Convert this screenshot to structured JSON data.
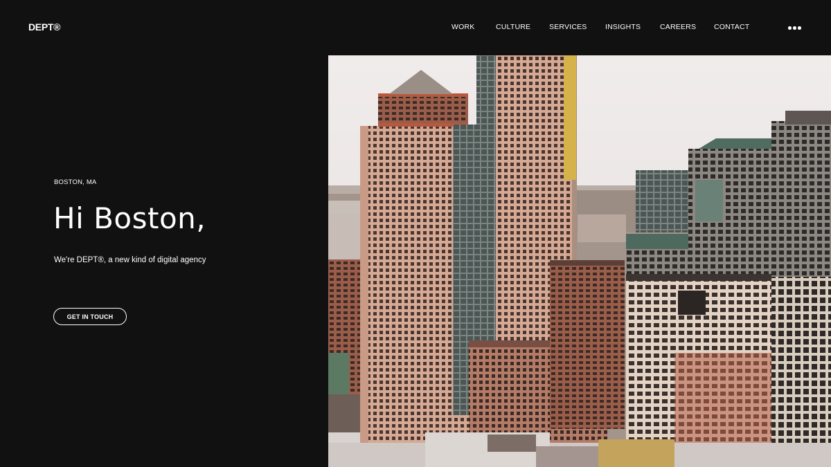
{
  "header": {
    "logo": "DEPT®",
    "nav": [
      "WORK",
      "CULTURE",
      "SERVICES",
      "INSIGHTS",
      "CAREERS",
      "CONTACT"
    ],
    "more_icon": "more-horizontal-icon"
  },
  "hero": {
    "location": "BOSTON, MA",
    "headline": "Hi Boston,",
    "subtitle": "We're DEPT®, a new kind of digital agency",
    "cta_label": "GET IN TOUCH"
  },
  "colors": {
    "background": "#111111",
    "text": "#ffffff"
  }
}
